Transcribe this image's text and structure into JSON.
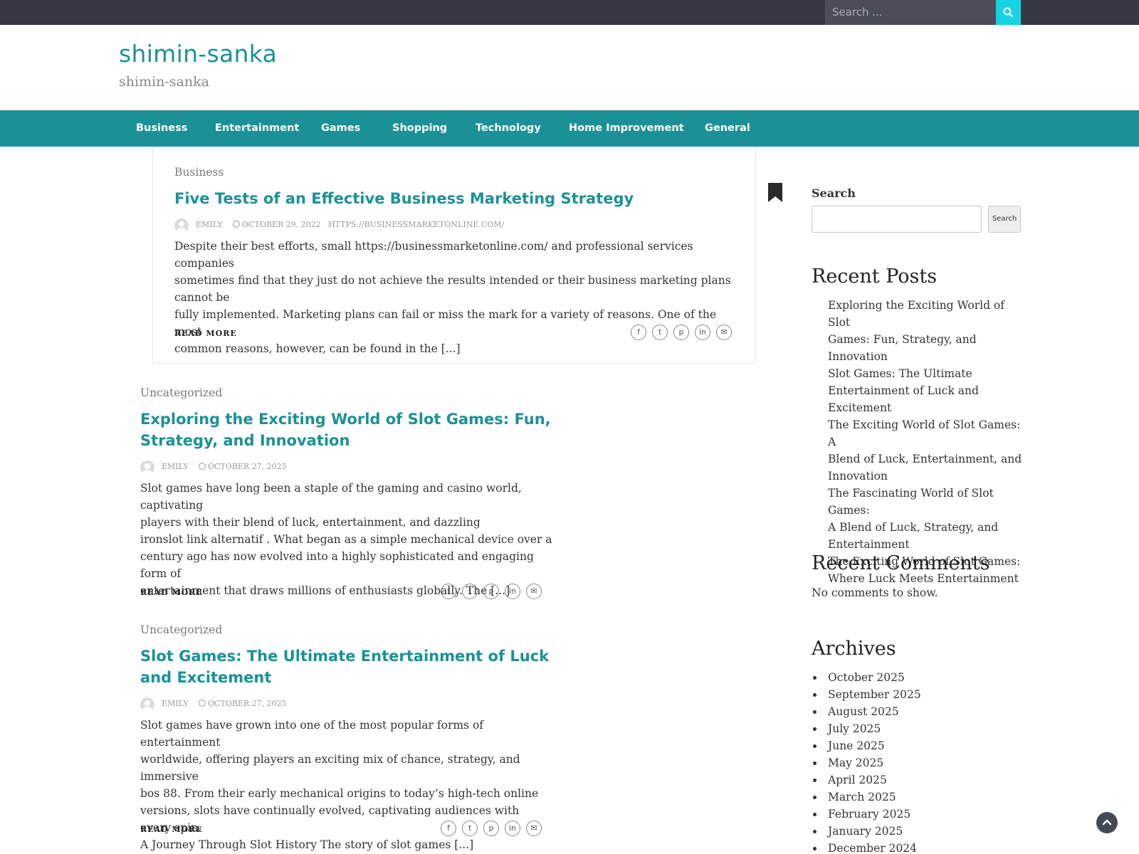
{
  "topbar": {
    "search_placeholder": "Search ...",
    "search_icon": "search-icon"
  },
  "header": {
    "title": "shimin-sanka",
    "description": "shimin-sanka"
  },
  "nav": {
    "items": [
      "Business",
      "Entertainment",
      "Games",
      "Shopping",
      "Technology",
      "Home Improvement",
      "General"
    ]
  },
  "posts": [
    {
      "category": "Business",
      "title": "Five Tests of an Effective Business Marketing Strategy",
      "author": "EMILY",
      "date": "OCTOBER 29, 2022",
      "link": "HTTPS://BUSINESSMARKETONLINE.COM/",
      "excerpt_lines": [
        "Despite their best efforts, small https://businessmarketonline.com/ and professional services companies",
        "sometimes find that they just do not achieve the results intended or their business marketing plans cannot be",
        "fully implemented. Marketing plans can fail or miss the mark for a variety of reasons. One of the most",
        "common reasons, however, can be found in the [...]"
      ],
      "read_more": "READ MORE"
    },
    {
      "category": "Uncategorized",
      "title_lines": [
        "Exploring the Exciting World of Slot Games: Fun,",
        "Strategy, and Innovation"
      ],
      "author": "EMILY",
      "date": "OCTOBER 27, 2025",
      "excerpt_lines": [
        "Slot games have long been a staple of the gaming and casino world, captivating",
        "players with their blend of luck, entertainment, and dazzling",
        "ironslot link alternatif . What began as a simple mechanical device over a",
        "century ago has now evolved into a highly sophisticated and engaging form of",
        "entertainment that draws millions of enthusiasts globally. The [...]"
      ],
      "read_more": "READ MORE"
    },
    {
      "category": "Uncategorized",
      "title_lines": [
        "Slot Games: The Ultimate Entertainment of Luck",
        "and Excitement"
      ],
      "author": "EMILY",
      "date": "OCTOBER 27, 2025",
      "excerpt_lines": [
        "Slot games have grown into one of the most popular forms of entertainment",
        "worldwide, offering players an exciting mix of chance, strategy, and immersive",
        "bos 88. From their early mechanical origins to today’s high-tech online",
        "versions, slots have continually evolved, captivating audiences with every spin.",
        "A Journey Through Slot History The story of slot games [...]"
      ],
      "read_more": "READ MORE"
    }
  ],
  "share_icons": [
    "facebook-icon",
    "twitter-icon",
    "pinterest-icon",
    "linkedin-icon",
    "email-icon"
  ],
  "sidebar": {
    "search_label": "Search",
    "search_button": "Search",
    "recent_posts_title": "Recent Posts",
    "recent_posts": [
      [
        "Exploring the Exciting World of Slot",
        "Games: Fun, Strategy, and Innovation"
      ],
      [
        "Slot Games: The Ultimate",
        "Entertainment of Luck and",
        "Excitement"
      ],
      [
        "The Exciting World of Slot Games: A",
        "Blend of Luck, Entertainment, and",
        "Innovation"
      ],
      [
        "The Fascinating World of Slot Games:",
        "A Blend of Luck, Strategy, and",
        "Entertainment"
      ],
      [
        "The Exciting World of Slot Games:",
        "Where Luck Meets Entertainment"
      ]
    ],
    "recent_comments_title": "Recent Comments",
    "no_comments": "No comments to show.",
    "archives_title": "Archives",
    "archives": [
      "October 2025",
      "September 2025",
      "August 2025",
      "July 2025",
      "June 2025",
      "May 2025",
      "April 2025",
      "March 2025",
      "February 2025",
      "January 2025",
      "December 2024"
    ]
  },
  "colors": {
    "accent": "#1b9197",
    "topbar": "#363944",
    "search_button": "#16d3e4"
  }
}
